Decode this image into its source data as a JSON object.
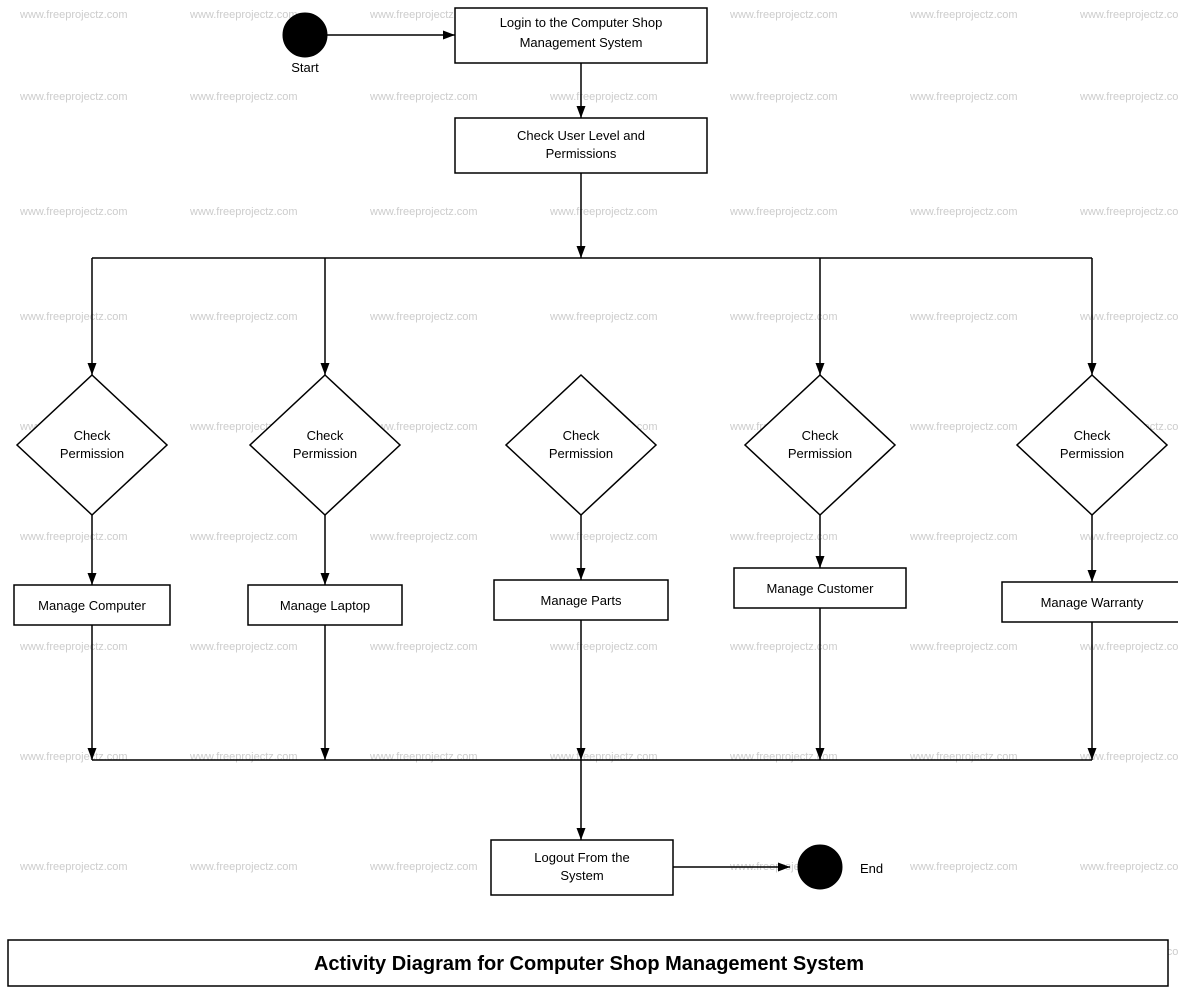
{
  "diagram": {
    "title": "Activity Diagram for Computer Shop Management System",
    "watermark": "www.freeprojectz.com",
    "nodes": {
      "start_label": "Start",
      "login_box": "Login to the Computer Shop Management System",
      "check_user": "Check User Level and Permissions",
      "check_perm1": "Check Permission",
      "check_perm2": "Check Permission",
      "check_perm3": "Check Permission",
      "check_perm4": "Check Permission",
      "check_perm5": "Check Permission",
      "manage_computer": "Manage Computer",
      "manage_laptop": "Manage Laptop",
      "manage_parts": "Manage Parts",
      "manage_customer": "Manage Customer",
      "manage_warranty": "Manage Warranty",
      "logout": "Logout From the System",
      "end_label": "End"
    }
  }
}
